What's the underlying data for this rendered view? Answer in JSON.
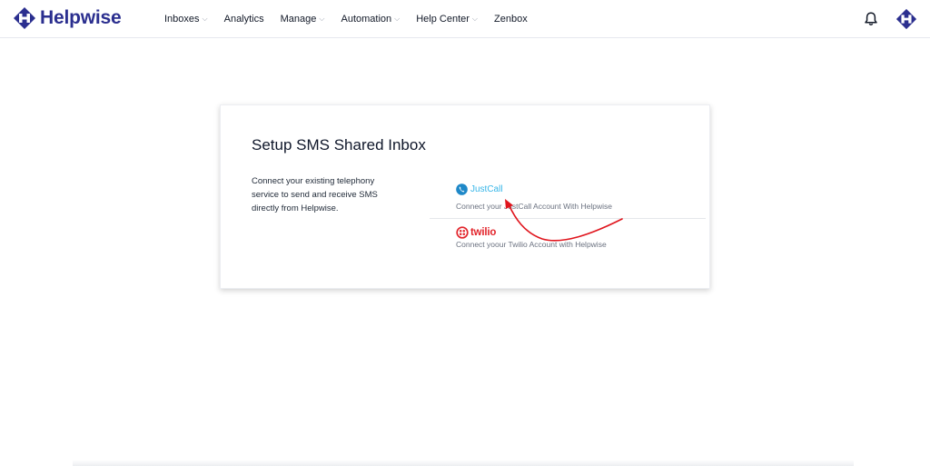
{
  "brand": {
    "name": "Helpwise",
    "icon": "helpwise-logo-icon",
    "color": "#2b2f8f"
  },
  "nav": {
    "items": [
      {
        "label": "Inboxes",
        "has_dropdown": true
      },
      {
        "label": "Analytics",
        "has_dropdown": false
      },
      {
        "label": "Manage",
        "has_dropdown": true
      },
      {
        "label": "Automation",
        "has_dropdown": true
      },
      {
        "label": "Help Center",
        "has_dropdown": true
      },
      {
        "label": "Zenbox",
        "has_dropdown": false
      }
    ],
    "chevron": "⌵",
    "bell_icon": "bell-icon"
  },
  "card": {
    "title": "Setup SMS Shared Inbox",
    "description": "Connect your existing telephony service to send and receive SMS directly from Helpwise."
  },
  "providers": {
    "justcall": {
      "name": "JustCall",
      "description": "Connect your JustCall Account With Helpwise",
      "color": "#37b6e8"
    },
    "twilio": {
      "name": "twilio",
      "description": "Connect yoour Twilio Account with Helpwise",
      "color": "#e2242b"
    }
  },
  "annotation": {
    "icon": "red-arrow-annotation",
    "color": "#e0151d"
  }
}
